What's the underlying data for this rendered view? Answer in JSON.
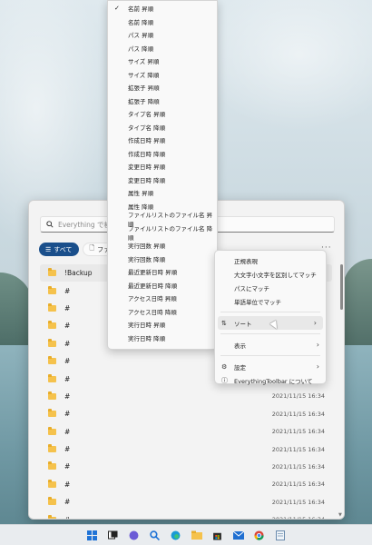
{
  "search": {
    "placeholder": "Everything で検索"
  },
  "filters": {
    "all": "すべて",
    "file": "ファイ"
  },
  "more_glyph": "···",
  "rows": [
    {
      "name": "!Backup",
      "date": ""
    },
    {
      "name": "#",
      "date": ""
    },
    {
      "name": "#",
      "date": ""
    },
    {
      "name": "#",
      "date": ""
    },
    {
      "name": "#",
      "date": ""
    },
    {
      "name": "#",
      "date": ""
    },
    {
      "name": "#",
      "date": "2021/11/15 16:34"
    },
    {
      "name": "#",
      "date": "2021/11/15 16:34"
    },
    {
      "name": "#",
      "date": "2021/11/15 16:34"
    },
    {
      "name": "#",
      "date": "2021/11/15 16:34"
    },
    {
      "name": "#",
      "date": "2021/11/15 16:34"
    },
    {
      "name": "#",
      "date": "2021/11/15 16:34"
    },
    {
      "name": "#",
      "date": "2021/11/15 16:34"
    },
    {
      "name": "#",
      "date": "2021/11/15 16:34"
    },
    {
      "name": "#",
      "date": "2021/11/15 16:34"
    }
  ],
  "sort_menu": {
    "checked_index": 0,
    "items": [
      "名前 昇順",
      "名前 降順",
      "パス 昇順",
      "パス 降順",
      "サイズ 昇順",
      "サイズ 降順",
      "拡張子 昇順",
      "拡張子 降順",
      "タイプ名 昇順",
      "タイプ名 降順",
      "作成日時 昇順",
      "作成日時 降順",
      "変更日時 昇順",
      "変更日時 降順",
      "属性 昇順",
      "属性 降順",
      "ファイルリストのファイル名 昇順",
      "ファイルリストのファイル名 降順",
      "実行回数 昇順",
      "実行回数 降順",
      "最近更新日時 昇順",
      "最近更新日時 降順",
      "アクセス日時 昇順",
      "アクセス日時 降順",
      "実行日時 昇順",
      "実行日時 降順"
    ]
  },
  "context_menu": {
    "regex": "正規表現",
    "match_case": "大文字小文字を区別してマッチ",
    "match_path": "パスにマッチ",
    "match_word": "単語単位でマッチ",
    "sort": "ソート",
    "view": "表示",
    "settings": "設定",
    "about": "EverythingToolbar について"
  },
  "colors": {
    "accent": "#1a4f8b",
    "folder": "#f5c24c"
  }
}
